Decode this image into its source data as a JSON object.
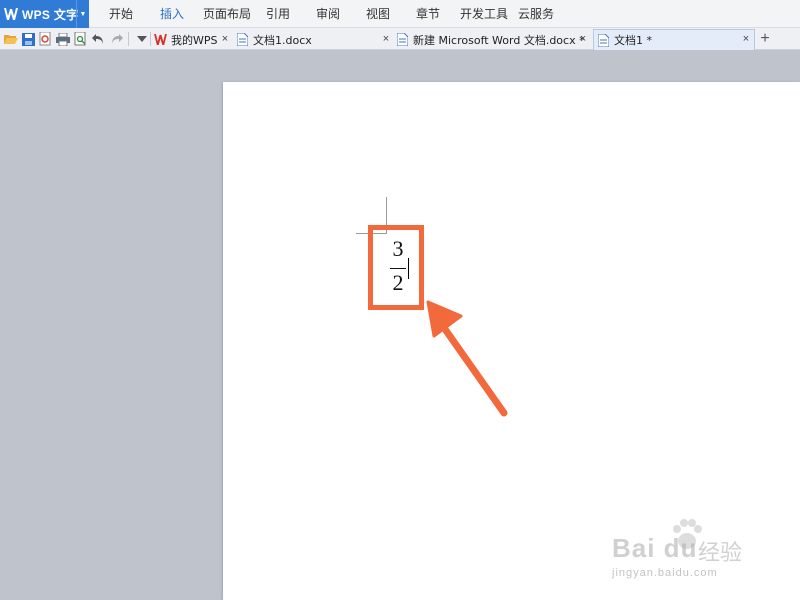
{
  "app": {
    "title": "WPS 文字",
    "logo_icon": "wps-w-icon",
    "accent": "#2f7bd6"
  },
  "menu": {
    "items": [
      "开始",
      "插入",
      "页面布局",
      "引用",
      "审阅",
      "视图",
      "章节",
      "开发工具",
      "云服务"
    ],
    "active": "插入"
  },
  "quick_access": [
    "open-folder-icon",
    "save-icon",
    "export-pdf-icon",
    "print-icon",
    "print-preview-icon",
    "undo-icon",
    "redo-icon",
    "customize-dropdown-icon"
  ],
  "tabs": [
    {
      "label": "我的WPS",
      "icon": "wps-home-icon",
      "active": false
    },
    {
      "label": "文档1.docx",
      "icon": "document-icon",
      "active": false
    },
    {
      "label": "新建 Microsoft Word 文档.docx *",
      "icon": "document-icon",
      "active": false
    },
    {
      "label": "文档1 *",
      "icon": "document-icon",
      "active": true
    }
  ],
  "tab_close_glyph": "×",
  "add_tab_glyph": "+",
  "document": {
    "fraction": {
      "numerator": "3",
      "denominator": "2"
    },
    "highlight_color": "#f26a3c"
  },
  "watermark": {
    "brand": "Bai du",
    "product": "经验",
    "url": "jingyan.baidu.com"
  }
}
